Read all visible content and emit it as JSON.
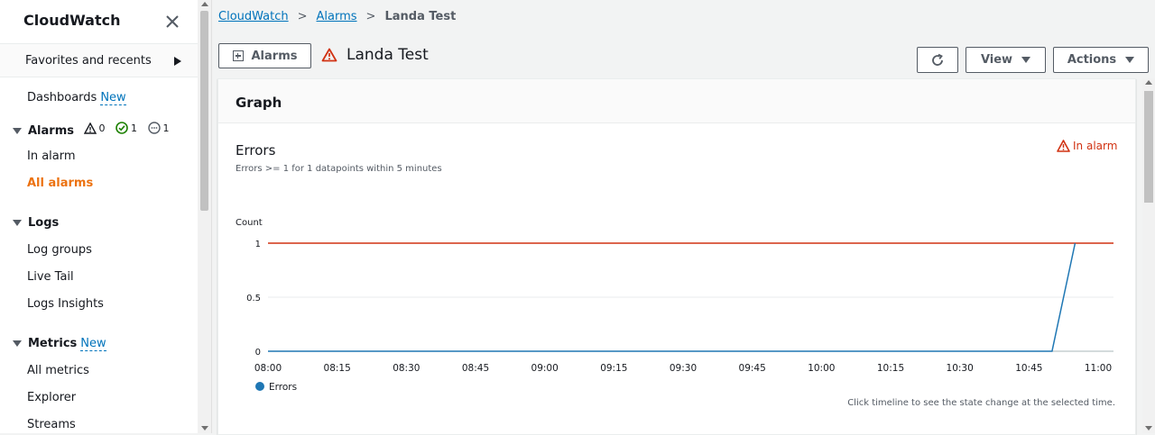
{
  "sidebar": {
    "title": "CloudWatch",
    "favorites_label": "Favorites and recents",
    "dashboards_label": "Dashboards",
    "new_badge": "New",
    "alarms_label": "Alarms",
    "alarm_counts": {
      "in_alarm": "0",
      "ok": "1",
      "insufficient": "1"
    },
    "alarm_items": [
      "In alarm",
      "All alarms"
    ],
    "logs_label": "Logs",
    "logs_items": [
      "Log groups",
      "Live Tail",
      "Logs Insights"
    ],
    "metrics_label": "Metrics",
    "metrics_items": [
      "All metrics",
      "Explorer",
      "Streams"
    ]
  },
  "breadcrumb": {
    "items": [
      "CloudWatch",
      "Alarms"
    ],
    "current": "Landa Test"
  },
  "header": {
    "alarms_button": "Alarms",
    "title": "Landa Test",
    "view_button": "View",
    "actions_button": "Actions"
  },
  "graph": {
    "panel_title": "Graph",
    "metric_title": "Errors",
    "condition": "Errors >= 1 for 1 datapoints within 5 minutes",
    "state": "In alarm",
    "note": "Click timeline to see the state change at the selected time."
  },
  "colors": {
    "series": "#1f77b4",
    "threshold": "#d13212",
    "active_nav": "#ec7211",
    "link": "#0073bb"
  },
  "chart_data": {
    "type": "line",
    "ylabel": "Count",
    "ylim": [
      0,
      1
    ],
    "y_ticks": [
      "1",
      "0.5",
      "0"
    ],
    "x_ticks": [
      "08:00",
      "08:15",
      "08:30",
      "08:45",
      "09:00",
      "09:15",
      "09:30",
      "09:45",
      "10:00",
      "10:15",
      "10:30",
      "10:45",
      "11:00"
    ],
    "threshold": 1,
    "series": [
      {
        "name": "Errors",
        "x": [
          "08:00",
          "10:50",
          "10:55"
        ],
        "y": [
          0,
          0,
          1
        ]
      }
    ]
  }
}
